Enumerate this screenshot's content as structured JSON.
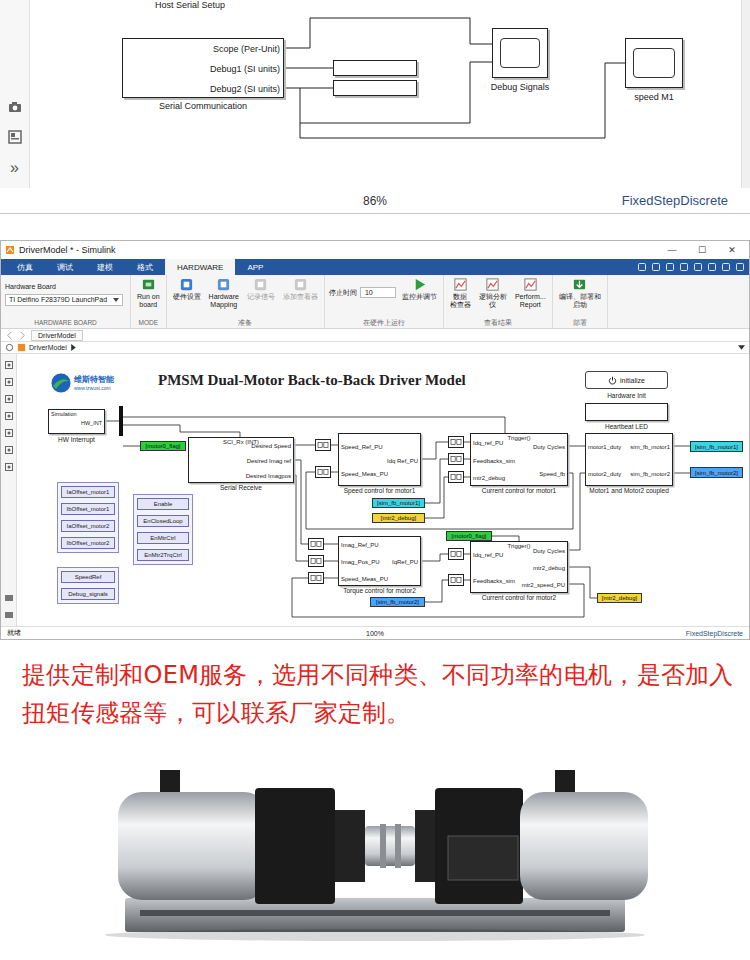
{
  "top_model": {
    "header_label": "Host Serial Setup",
    "side_toolbar": {
      "more": "»"
    },
    "serial_block": {
      "label": "Serial Communication",
      "ports": [
        "Scope (Per-Unit)",
        "Debug1 (SI units)",
        "Debug2 (SI units)"
      ]
    },
    "scopes": [
      {
        "label": "Debug Signals"
      },
      {
        "label": "speed M1"
      }
    ],
    "zoom": "86%",
    "solver": "FixedStepDiscrete"
  },
  "window": {
    "title": "DriverModel * - Simulink",
    "controls": [
      "—",
      "☐",
      "✕"
    ],
    "tabs": [
      {
        "label": "仿真",
        "selected": false
      },
      {
        "label": "调试",
        "selected": false
      },
      {
        "label": "建模",
        "selected": false
      },
      {
        "label": "格式",
        "selected": false
      },
      {
        "label": "HARDWARE",
        "selected": true
      },
      {
        "label": "APP",
        "selected": false
      }
    ],
    "ribbon": {
      "hardware_board": {
        "label": "Hardware Board",
        "value": "TI Delfino F28379D LaunchPad",
        "group": "HARDWARE BOARD"
      },
      "mode": {
        "lines": [
          "Run on",
          "board"
        ],
        "group": "MODE"
      },
      "prepare": {
        "items": [
          {
            "lines": [
              "硬件设置"
            ],
            "disabled": false
          },
          {
            "lines": [
              "Hardware",
              "Mapping"
            ],
            "disabled": false
          },
          {
            "lines": [
              "记录信号"
            ],
            "disabled": true
          },
          {
            "lines": [
              "添加查看器"
            ],
            "disabled": true
          }
        ],
        "group": "准备"
      },
      "run": {
        "stop_time_label": "停止时间",
        "stop_time": "10",
        "button": "监控并调节",
        "group": "在硬件上运行"
      },
      "results": {
        "items": [
          {
            "lines": [
              "数据",
              "检查器"
            ]
          },
          {
            "lines": [
              "逻辑分析",
              "仪"
            ]
          },
          {
            "lines": [
              "Perform...",
              "Report"
            ]
          }
        ],
        "group": "查看结果"
      },
      "deploy": {
        "lines": [
          "编译、部署和",
          "启动"
        ],
        "group": "部署"
      }
    },
    "model_tab": "DriverModel",
    "breadcrumb": "DriverModel",
    "status": {
      "state": "就绪",
      "zoom": "100%",
      "solver": "FixedStepDiscrete"
    }
  },
  "diagram": {
    "logo": {
      "name": "维斯特智能",
      "url": "www.izwust.com"
    },
    "title": "PMSM Dual-Motor Back-to-Back Driver Model",
    "init_button": {
      "label": "initialize",
      "caption": "Hardware Init"
    },
    "heartbeat": {
      "caption": "Heartbeat LED"
    },
    "hw_interrupt": {
      "texts": [
        "Simulation",
        "HW_INT"
      ],
      "caption": "HW Interrupt"
    },
    "blocks": [
      {
        "caption": "Serial Receive",
        "top": "SCI_Rx (INT)",
        "inputs": [],
        "outputs": [
          "Desired Speed",
          "Desired Imag ref",
          "Desired Imagpos"
        ]
      },
      {
        "caption": "Speed control for motor1",
        "inputs": [
          "Speed_Ref_PU",
          "Speed_Meas_PU"
        ],
        "outputs": [
          "Idq Ref_PU"
        ]
      },
      {
        "caption": "Current control for motor1",
        "top": "Trigger()",
        "inputs": [
          "Idq_ref_PU",
          "Feedbacks_sim",
          "mtr2_debug"
        ],
        "outputs": [
          "Duty Cycles",
          "Speed_fb"
        ]
      },
      {
        "caption": "Motor1 and Motor2 coupled",
        "inputs": [
          "motor1_duty",
          "motor2_duty"
        ],
        "outputs": [
          "sim_fb_motor1",
          "sim_fb_motor2"
        ]
      },
      {
        "caption": "Torque control for motor2",
        "inputs": [
          "Imag_Ref_PU",
          "Imag_Pos_PU",
          "Speed_Meas_PU"
        ],
        "outputs": [
          "IqRef_PU"
        ]
      },
      {
        "caption": "Current control for motor2",
        "top": "Trigger()",
        "inputs": [
          "Idq_ref_PU",
          "Feedbacks_sim"
        ],
        "outputs": [
          "Duty Cycles",
          "mtr2_debug",
          "mtr2_speed_PU"
        ]
      }
    ],
    "tags": [
      {
        "label": "[motor0_flag]",
        "color": "#2ecc40"
      },
      {
        "label": "[sim_fb_motor1]",
        "color": "#3dd3e6"
      },
      {
        "label": "[sim_fb_motor2]",
        "color": "#4da3f5"
      },
      {
        "label": "[sim_fb_motor1]",
        "color": "#3dd3e6"
      },
      {
        "label": "[mtr2_debug]",
        "color": "#f2d43c"
      },
      {
        "label": "[motor0_flag]",
        "color": "#2ecc40"
      },
      {
        "label": "[sim_fb_motor2]",
        "color": "#4da3f5"
      },
      {
        "label": "[mtr2_debug]",
        "color": "#f2d43c"
      }
    ],
    "param_groups": [
      {
        "items": [
          "IaOffset_motor1",
          "IbOffset_motor1",
          "IaOffset_motor2",
          "IbOffset_motor2"
        ]
      },
      {
        "items": [
          "Enable",
          "EnClosedLoop",
          "EnMtrCtrl",
          "EnMtr2TrqCtrl"
        ]
      },
      {
        "items": [
          "SpeedRef",
          "Debug_signals"
        ]
      }
    ]
  },
  "promo": "提供定制和OEM服务，选用不同种类、不同功率的电机，是否加入扭矩传感器等，可以联系厂家定制。"
}
